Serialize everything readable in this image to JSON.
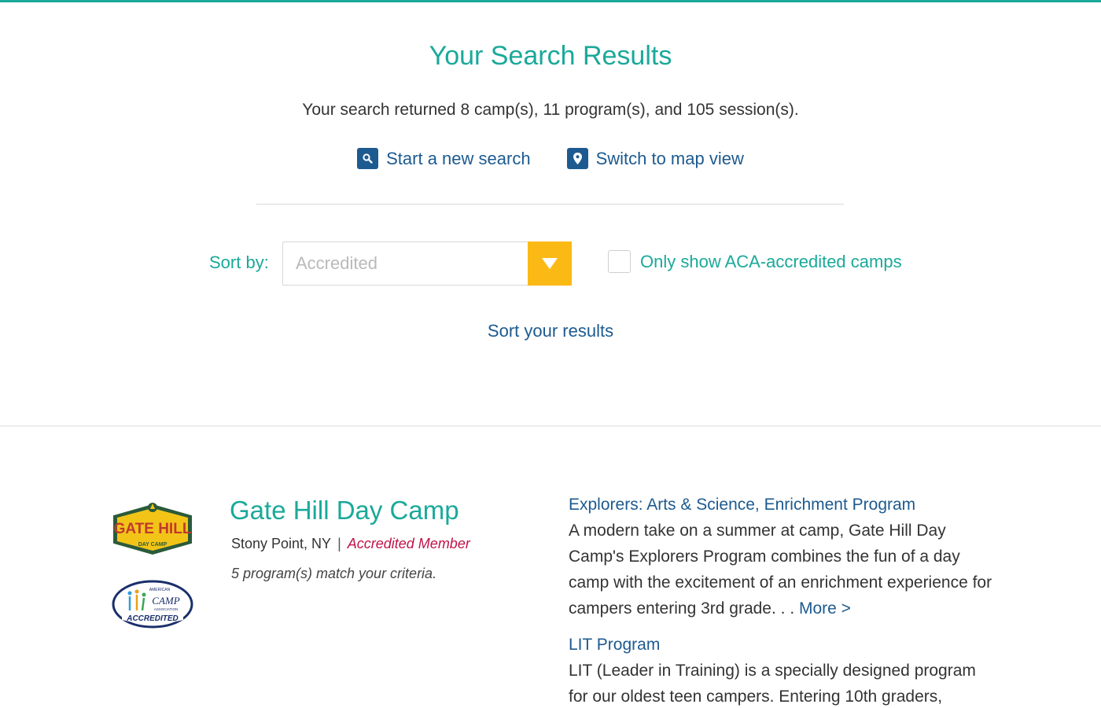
{
  "header": {
    "title": "Your Search Results",
    "summary": "Your search returned 8 camp(s), 11 program(s), and 105 session(s)."
  },
  "actions": {
    "new_search": "Start a new search",
    "map_view": "Switch to map view"
  },
  "sort": {
    "label": "Sort by:",
    "selected": "Accredited",
    "aca_checkbox_label": "Only show ACA-accredited camps",
    "aca_checked": false,
    "sort_results_link": "Sort your results"
  },
  "camp": {
    "name": "Gate Hill Day Camp",
    "location": "Stony Point, NY",
    "separator": "|",
    "member_status": "Accredited Member",
    "match_text": "5 program(s) match your criteria.",
    "logo_text_main": "GATE HILL",
    "logo_text_sub": "DAY CAMP",
    "badge_text": "ACCREDITED",
    "badge_brand": "CAMP",
    "badge_top": "AMERICAN",
    "badge_bottom": "ASSOCIATION",
    "programs": [
      {
        "title": "Explorers: Arts & Science, Enrichment Program",
        "description": "A modern take on a summer at camp, Gate Hill Day Camp's Explorers Program combines the fun of a day camp with the excitement of an enrichment experience for campers entering 3rd grade. . .",
        "more": "More >"
      },
      {
        "title": "LIT Program",
        "description": "LIT (Leader in Training) is a specially designed program for our oldest teen campers. Entering 10th graders,",
        "more": ""
      }
    ]
  },
  "colors": {
    "teal": "#1aa99a",
    "navy": "#1d5a8f",
    "yellow": "#fbb916",
    "crimson": "#c0144a"
  },
  "icons": {
    "new_search": "search-icon",
    "map_view": "map-pin-icon",
    "select_toggle": "caret-down-icon"
  }
}
